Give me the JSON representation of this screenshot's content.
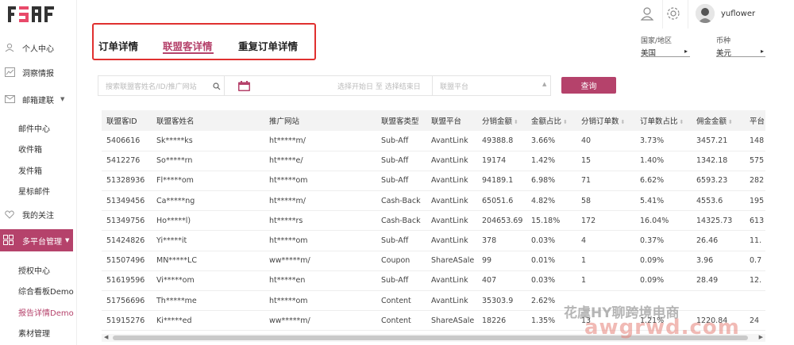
{
  "sidebar": {
    "logo_text": "FSAF",
    "items": [
      {
        "label": "个人中心",
        "icon": "user-icon"
      },
      {
        "label": "洞察情报",
        "icon": "chart-icon"
      },
      {
        "label": "邮箱建联",
        "icon": "mail-icon"
      }
    ],
    "mail_sub": [
      "邮件中心",
      "收件箱",
      "发件箱",
      "星标邮件"
    ],
    "follow": {
      "label": "我的关注",
      "icon": "heart-icon"
    },
    "platform": {
      "label": "多平台管理",
      "icon": "grid-icon"
    },
    "platform_sub": [
      "授权中心",
      "综合看板Demo",
      "报告详情Demo",
      "素材管理"
    ]
  },
  "header": {
    "username": "yuflower"
  },
  "tabs": [
    "订单详情",
    "联盟客详情",
    "重复订单详情"
  ],
  "region": {
    "label": "国家/地区",
    "value": "美国"
  },
  "currency": {
    "label": "币种",
    "value": "美元"
  },
  "filters": {
    "search_placeholder": "搜索联盟客姓名/ID/推广网站",
    "date_placeholder": "选择开始日 至 选择结束日",
    "platform_placeholder": "联盟平台",
    "query_label": "查询"
  },
  "table": {
    "columns": [
      "联盟客ID",
      "联盟客姓名",
      "推广网站",
      "联盟客类型",
      "联盟平台",
      "分销金额",
      "金额占比",
      "分销订单数",
      "订单数占比",
      "佣金金额",
      "平台"
    ],
    "rows": [
      [
        "5406616",
        "Sk*****ks",
        "ht*****m/",
        "Sub-Aff",
        "AvantLink",
        "49388.8",
        "3.66%",
        "40",
        "3.73%",
        "3457.21",
        "148"
      ],
      [
        "5412276",
        "So*****rn",
        "ht*****e/",
        "Sub-Aff",
        "AvantLink",
        "19174",
        "1.42%",
        "15",
        "1.40%",
        "1342.18",
        "575"
      ],
      [
        "51328936",
        "Fl*****om",
        "ht*****om",
        "Sub-Aff",
        "AvantLink",
        "94189.1",
        "6.98%",
        "71",
        "6.62%",
        "6593.23",
        "282"
      ],
      [
        "51349456",
        "Ca*****ng",
        "ht*****m/",
        "Cash-Back",
        "AvantLink",
        "65051.6",
        "4.82%",
        "58",
        "5.41%",
        "4553.6",
        "195"
      ],
      [
        "51349756",
        "Ho*****l)",
        "ht*****rs",
        "Cash-Back",
        "AvantLink",
        "204653.69",
        "15.18%",
        "172",
        "16.04%",
        "14325.73",
        "613"
      ],
      [
        "51424826",
        "Yi*****it",
        "ht*****om",
        "Sub-Aff",
        "AvantLink",
        "378",
        "0.03%",
        "4",
        "0.37%",
        "26.46",
        "11."
      ],
      [
        "51507496",
        "MN*****LC",
        "ww*****m/",
        "Coupon",
        "ShareASale",
        "99",
        "0.01%",
        "1",
        "0.09%",
        "3.96",
        "0.7"
      ],
      [
        "51619596",
        "Vi*****om",
        "ht*****en",
        "Sub-Aff",
        "AvantLink",
        "407",
        "0.03%",
        "1",
        "0.09%",
        "28.49",
        "12."
      ],
      [
        "51756696",
        "Th*****me",
        "ht*****om",
        "Content",
        "AvantLink",
        "35303.9",
        "2.62%",
        "",
        "",
        "",
        ""
      ],
      [
        "51915276",
        "Ki*****ed",
        "ww*****m/",
        "Content",
        "ShareASale",
        "18226",
        "1.35%",
        "13",
        "1.21%",
        "1220.84",
        "24"
      ]
    ]
  },
  "watermark": {
    "line1": "花虞HY聊跨境电商",
    "line2": "awgrwd.com"
  },
  "colors": {
    "accent": "#b5426b",
    "highlight_border": "#e0302f"
  }
}
